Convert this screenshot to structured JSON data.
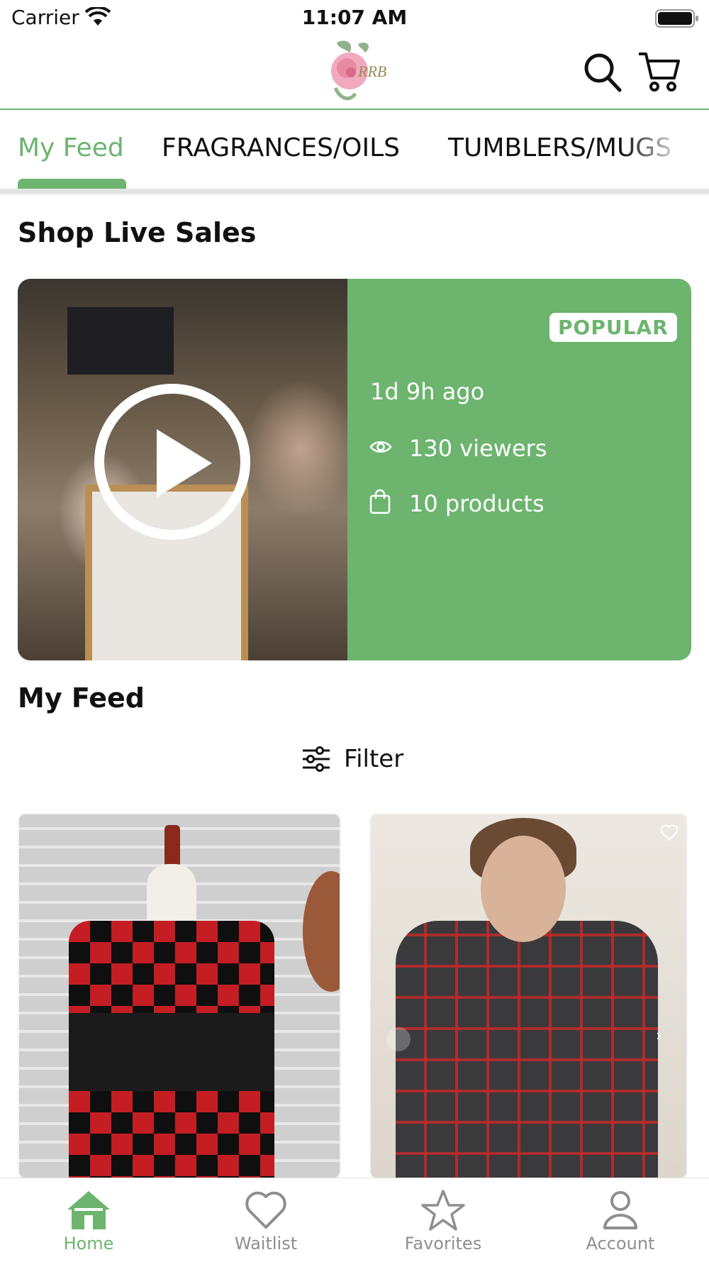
{
  "status_bar": {
    "carrier": "Carrier",
    "time": "11:07 AM"
  },
  "header": {
    "logo_text": "RRB"
  },
  "tabs": [
    {
      "label": "My Feed",
      "active": true
    },
    {
      "label": "FRAGRANCES/OILS",
      "active": false
    },
    {
      "label": "TUMBLERS/MUGS",
      "active": false
    }
  ],
  "live_sales": {
    "title": "Shop Live Sales",
    "badge": "POPULAR",
    "time_ago": "1d 9h ago",
    "viewers": "130 viewers",
    "products": "10 products"
  },
  "feed": {
    "title": "My Feed",
    "filter_label": "Filter"
  },
  "bottom_nav": [
    {
      "label": "Home",
      "icon": "home-icon",
      "active": true
    },
    {
      "label": "Waitlist",
      "icon": "heart-icon",
      "active": false
    },
    {
      "label": "Favorites",
      "icon": "star-icon",
      "active": false
    },
    {
      "label": "Account",
      "icon": "person-icon",
      "active": false
    }
  ],
  "colors": {
    "accent": "#6db46f",
    "inactive": "#8e8e8e"
  }
}
